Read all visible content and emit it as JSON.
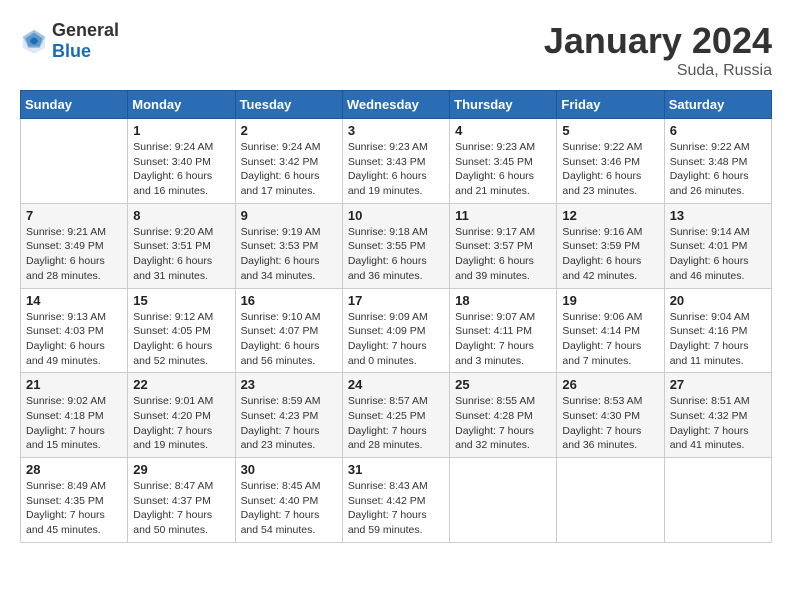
{
  "logo": {
    "text_general": "General",
    "text_blue": "Blue"
  },
  "title": "January 2024",
  "location": "Suda, Russia",
  "days_of_week": [
    "Sunday",
    "Monday",
    "Tuesday",
    "Wednesday",
    "Thursday",
    "Friday",
    "Saturday"
  ],
  "weeks": [
    [
      {
        "day": "",
        "info": ""
      },
      {
        "day": "1",
        "info": "Sunrise: 9:24 AM\nSunset: 3:40 PM\nDaylight: 6 hours\nand 16 minutes."
      },
      {
        "day": "2",
        "info": "Sunrise: 9:24 AM\nSunset: 3:42 PM\nDaylight: 6 hours\nand 17 minutes."
      },
      {
        "day": "3",
        "info": "Sunrise: 9:23 AM\nSunset: 3:43 PM\nDaylight: 6 hours\nand 19 minutes."
      },
      {
        "day": "4",
        "info": "Sunrise: 9:23 AM\nSunset: 3:45 PM\nDaylight: 6 hours\nand 21 minutes."
      },
      {
        "day": "5",
        "info": "Sunrise: 9:22 AM\nSunset: 3:46 PM\nDaylight: 6 hours\nand 23 minutes."
      },
      {
        "day": "6",
        "info": "Sunrise: 9:22 AM\nSunset: 3:48 PM\nDaylight: 6 hours\nand 26 minutes."
      }
    ],
    [
      {
        "day": "7",
        "info": "Sunrise: 9:21 AM\nSunset: 3:49 PM\nDaylight: 6 hours\nand 28 minutes."
      },
      {
        "day": "8",
        "info": "Sunrise: 9:20 AM\nSunset: 3:51 PM\nDaylight: 6 hours\nand 31 minutes."
      },
      {
        "day": "9",
        "info": "Sunrise: 9:19 AM\nSunset: 3:53 PM\nDaylight: 6 hours\nand 34 minutes."
      },
      {
        "day": "10",
        "info": "Sunrise: 9:18 AM\nSunset: 3:55 PM\nDaylight: 6 hours\nand 36 minutes."
      },
      {
        "day": "11",
        "info": "Sunrise: 9:17 AM\nSunset: 3:57 PM\nDaylight: 6 hours\nand 39 minutes."
      },
      {
        "day": "12",
        "info": "Sunrise: 9:16 AM\nSunset: 3:59 PM\nDaylight: 6 hours\nand 42 minutes."
      },
      {
        "day": "13",
        "info": "Sunrise: 9:14 AM\nSunset: 4:01 PM\nDaylight: 6 hours\nand 46 minutes."
      }
    ],
    [
      {
        "day": "14",
        "info": "Sunrise: 9:13 AM\nSunset: 4:03 PM\nDaylight: 6 hours\nand 49 minutes."
      },
      {
        "day": "15",
        "info": "Sunrise: 9:12 AM\nSunset: 4:05 PM\nDaylight: 6 hours\nand 52 minutes."
      },
      {
        "day": "16",
        "info": "Sunrise: 9:10 AM\nSunset: 4:07 PM\nDaylight: 6 hours\nand 56 minutes."
      },
      {
        "day": "17",
        "info": "Sunrise: 9:09 AM\nSunset: 4:09 PM\nDaylight: 7 hours\nand 0 minutes."
      },
      {
        "day": "18",
        "info": "Sunrise: 9:07 AM\nSunset: 4:11 PM\nDaylight: 7 hours\nand 3 minutes."
      },
      {
        "day": "19",
        "info": "Sunrise: 9:06 AM\nSunset: 4:14 PM\nDaylight: 7 hours\nand 7 minutes."
      },
      {
        "day": "20",
        "info": "Sunrise: 9:04 AM\nSunset: 4:16 PM\nDaylight: 7 hours\nand 11 minutes."
      }
    ],
    [
      {
        "day": "21",
        "info": "Sunrise: 9:02 AM\nSunset: 4:18 PM\nDaylight: 7 hours\nand 15 minutes."
      },
      {
        "day": "22",
        "info": "Sunrise: 9:01 AM\nSunset: 4:20 PM\nDaylight: 7 hours\nand 19 minutes."
      },
      {
        "day": "23",
        "info": "Sunrise: 8:59 AM\nSunset: 4:23 PM\nDaylight: 7 hours\nand 23 minutes."
      },
      {
        "day": "24",
        "info": "Sunrise: 8:57 AM\nSunset: 4:25 PM\nDaylight: 7 hours\nand 28 minutes."
      },
      {
        "day": "25",
        "info": "Sunrise: 8:55 AM\nSunset: 4:28 PM\nDaylight: 7 hours\nand 32 minutes."
      },
      {
        "day": "26",
        "info": "Sunrise: 8:53 AM\nSunset: 4:30 PM\nDaylight: 7 hours\nand 36 minutes."
      },
      {
        "day": "27",
        "info": "Sunrise: 8:51 AM\nSunset: 4:32 PM\nDaylight: 7 hours\nand 41 minutes."
      }
    ],
    [
      {
        "day": "28",
        "info": "Sunrise: 8:49 AM\nSunset: 4:35 PM\nDaylight: 7 hours\nand 45 minutes."
      },
      {
        "day": "29",
        "info": "Sunrise: 8:47 AM\nSunset: 4:37 PM\nDaylight: 7 hours\nand 50 minutes."
      },
      {
        "day": "30",
        "info": "Sunrise: 8:45 AM\nSunset: 4:40 PM\nDaylight: 7 hours\nand 54 minutes."
      },
      {
        "day": "31",
        "info": "Sunrise: 8:43 AM\nSunset: 4:42 PM\nDaylight: 7 hours\nand 59 minutes."
      },
      {
        "day": "",
        "info": ""
      },
      {
        "day": "",
        "info": ""
      },
      {
        "day": "",
        "info": ""
      }
    ]
  ]
}
